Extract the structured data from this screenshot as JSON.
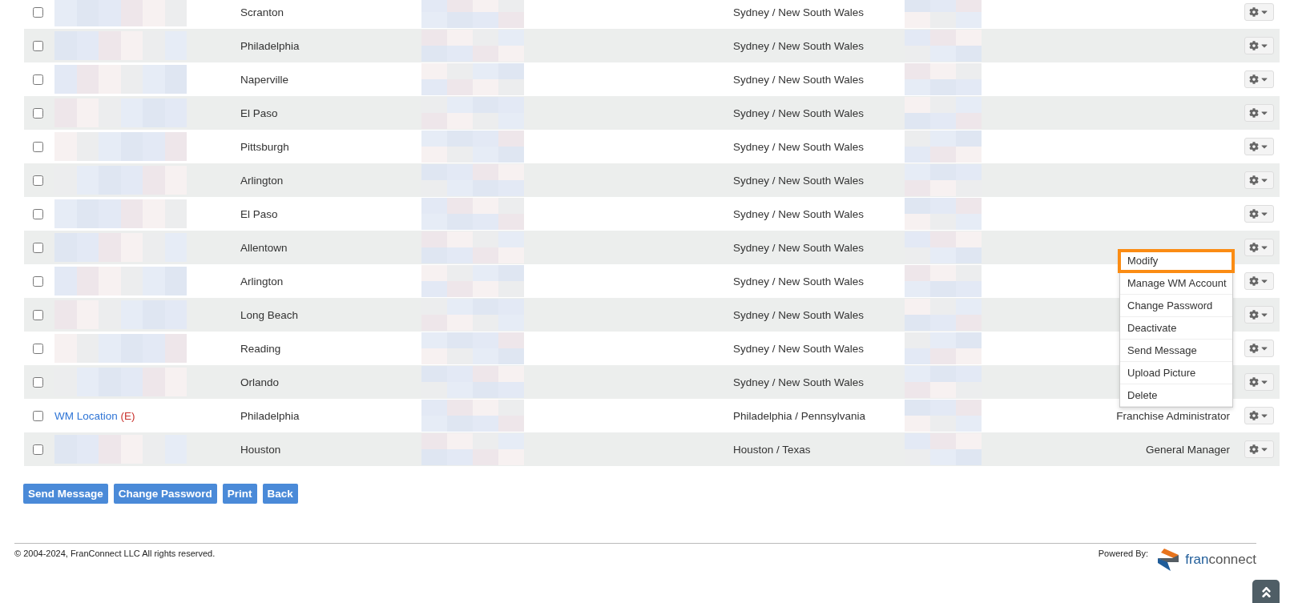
{
  "rows": [
    {
      "checked": false,
      "name": {
        "kind": "redacted"
      },
      "city": "Scranton",
      "location": "Sydney / New South Wales",
      "menu_open": false
    },
    {
      "checked": false,
      "name": {
        "kind": "redacted"
      },
      "city": "Philadelphia",
      "location": "Sydney / New South Wales",
      "menu_open": false
    },
    {
      "checked": false,
      "name": {
        "kind": "redacted"
      },
      "city": "Naperville",
      "location": "Sydney / New South Wales",
      "menu_open": false
    },
    {
      "checked": false,
      "name": {
        "kind": "redacted"
      },
      "city": "El Paso",
      "location": "Sydney / New South Wales",
      "menu_open": false
    },
    {
      "checked": false,
      "name": {
        "kind": "redacted"
      },
      "city": "Pittsburgh",
      "location": "Sydney / New South Wales",
      "menu_open": false
    },
    {
      "checked": false,
      "name": {
        "kind": "redacted"
      },
      "city": "Arlington",
      "location": "Sydney / New South Wales",
      "menu_open": false
    },
    {
      "checked": false,
      "name": {
        "kind": "redacted"
      },
      "city": "El Paso",
      "location": "Sydney / New South Wales",
      "menu_open": false
    },
    {
      "checked": false,
      "name": {
        "kind": "redacted"
      },
      "city": "Allentown",
      "location": "Sydney / New South Wales",
      "menu_open": true
    },
    {
      "checked": false,
      "name": {
        "kind": "redacted"
      },
      "city": "Arlington",
      "location": "Sydney / New South Wales",
      "menu_open": false
    },
    {
      "checked": false,
      "name": {
        "kind": "redacted"
      },
      "city": "Long Beach",
      "location": "Sydney / New South Wales",
      "menu_open": false
    },
    {
      "checked": false,
      "name": {
        "kind": "redacted"
      },
      "city": "Reading",
      "location": "Sydney / New South Wales",
      "menu_open": false
    },
    {
      "checked": false,
      "name": {
        "kind": "redacted"
      },
      "city": "Orlando",
      "location": "Sydney / New South Wales",
      "menu_open": false
    },
    {
      "checked": false,
      "name": {
        "kind": "link",
        "text": "WM Location",
        "tag": "(E)"
      },
      "city": "Philadelphia",
      "location": "Philadelphia / Pennsylvania",
      "role": "Franchise Administrator",
      "menu_open": false
    },
    {
      "checked": false,
      "name": {
        "kind": "redacted"
      },
      "city": "Houston",
      "location": "Houston / Texas",
      "role": "General Manager",
      "menu_open": false
    }
  ],
  "action_menu": {
    "items": [
      {
        "label": "Modify",
        "highlighted": true
      },
      {
        "label": "Manage WM Account",
        "highlighted": false
      },
      {
        "label": "Change Password",
        "highlighted": false
      },
      {
        "label": "Deactivate",
        "highlighted": false
      },
      {
        "label": "Send Message",
        "highlighted": false
      },
      {
        "label": "Upload Picture",
        "highlighted": false
      },
      {
        "label": "Delete",
        "highlighted": false
      }
    ]
  },
  "buttons": [
    "Send Message",
    "Change Password",
    "Print",
    "Back"
  ],
  "footer": {
    "copyright": "© 2004-2024, FranConnect LLC All rights reserved.",
    "powered_by": "Powered By:",
    "logo": {
      "part_1": "fran",
      "part_2": "connect"
    }
  }
}
